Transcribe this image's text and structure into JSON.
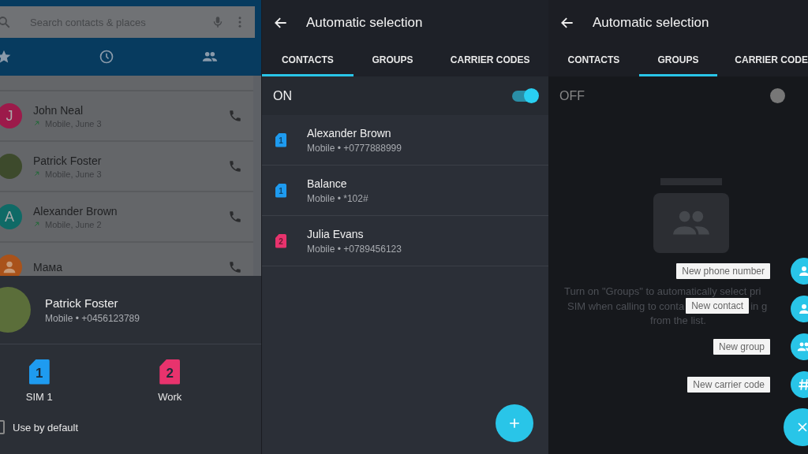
{
  "call_log_screen": {
    "search": {
      "placeholder": "Search contacts & places"
    },
    "calls": [
      {
        "name": "John Neal",
        "detail": "Mobile, June 3",
        "avatar": {
          "kind": "letter",
          "letter": "J",
          "color": "#9c1a4a"
        }
      },
      {
        "name": "Patrick Foster",
        "detail": "Mobile, June 3",
        "avatar": {
          "kind": "photo"
        }
      },
      {
        "name": "Alexander Brown",
        "detail": "Mobile, June 2",
        "avatar": {
          "kind": "letter",
          "letter": "A",
          "color": "#0f6a66"
        }
      },
      {
        "name": "Мама",
        "avatar": {
          "kind": "silhouette",
          "color": "#a9521a"
        }
      }
    ],
    "sim_dialog": {
      "contact": {
        "name": "Patrick Foster",
        "detail": "Mobile • +0456123789"
      },
      "sims": [
        {
          "number": "1",
          "label": "SIM 1",
          "color": "#1e9bf0"
        },
        {
          "number": "2",
          "label": "Work",
          "color": "#e8336d"
        }
      ],
      "default_option": {
        "label": "Use by default",
        "checked": false
      }
    }
  },
  "contacts_screen": {
    "title": "Automatic selection",
    "tabs": [
      {
        "label": "CONTACTS",
        "selected": true
      },
      {
        "label": "GROUPS",
        "selected": false
      },
      {
        "label": "CARRIER CODES",
        "selected": false
      }
    ],
    "toggle": {
      "label": "ON",
      "on": true
    },
    "contacts": [
      {
        "name": "Alexander Brown",
        "detail": "Mobile • +0777888999",
        "sim": "1",
        "color": "#1e9bf0"
      },
      {
        "name": "Balance",
        "detail": "Mobile • *102#",
        "sim": "1",
        "color": "#1e9bf0"
      },
      {
        "name": "Julia Evans",
        "detail": "Mobile • +0789456123",
        "sim": "2",
        "color": "#e8336d"
      }
    ]
  },
  "groups_screen": {
    "title": "Automatic selection",
    "tabs": [
      {
        "label": "CONTACTS",
        "selected": false
      },
      {
        "label": "GROUPS",
        "selected": true
      },
      {
        "label": "CARRIER CODE",
        "selected": false
      }
    ],
    "toggle": {
      "label": "OFF",
      "on": false
    },
    "message": {
      "line_1": "Turn on \"Groups\" to automatically select pri",
      "line_2_start": "SIM when calling to conta",
      "line_2_end": "in g",
      "line_3": "from the list."
    },
    "menu": [
      {
        "label": "New phone number",
        "kind": "person"
      },
      {
        "label": "New contact",
        "kind": "person"
      },
      {
        "label": "New group",
        "kind": "people"
      },
      {
        "label": "New carrier code",
        "kind": "hash"
      }
    ]
  }
}
